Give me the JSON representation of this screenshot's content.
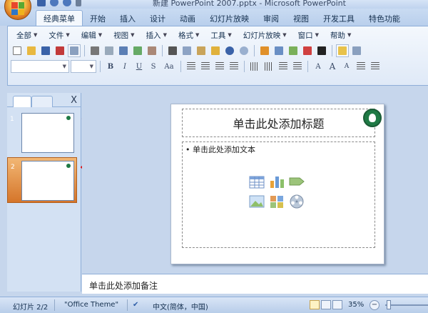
{
  "window": {
    "title": "新建 PowerPoint 2007.pptx - Microsoft PowerPoint"
  },
  "ribbon_tabs": [
    {
      "label": "经典菜单",
      "active": true
    },
    {
      "label": "开始",
      "active": false
    },
    {
      "label": "插入",
      "active": false
    },
    {
      "label": "设计",
      "active": false
    },
    {
      "label": "动画",
      "active": false
    },
    {
      "label": "幻灯片放映",
      "active": false
    },
    {
      "label": "审阅",
      "active": false
    },
    {
      "label": "视图",
      "active": false
    },
    {
      "label": "开发工具",
      "active": false
    },
    {
      "label": "特色功能",
      "active": false
    }
  ],
  "menubar": [
    {
      "label": "全部"
    },
    {
      "label": "文件"
    },
    {
      "label": "编辑"
    },
    {
      "label": "视图"
    },
    {
      "label": "插入"
    },
    {
      "label": "格式"
    },
    {
      "label": "工具"
    },
    {
      "label": "幻灯片放映"
    },
    {
      "label": "窗口"
    },
    {
      "label": "帮助"
    }
  ],
  "format_glyphs": {
    "bold": "B",
    "italic": "I",
    "underline": "U",
    "strike": "S",
    "case": "Aa",
    "font_color": "A",
    "grow": "A",
    "shrink": "A"
  },
  "slide_panel": {
    "close_label": "X",
    "slides": [
      {
        "number": "1"
      },
      {
        "number": "2"
      }
    ]
  },
  "slide": {
    "title_placeholder": "单击此处添加标题",
    "body_placeholder": "• 单击此处添加文本"
  },
  "notes": {
    "placeholder": "单击此处添加备注"
  },
  "statusbar": {
    "slide_counter": "幻灯片 2/2",
    "theme": "\"Office Theme\"",
    "language": "中文(简体，中国)",
    "zoom": "35%",
    "zoom_minus": "−",
    "zoom_plus": "+"
  },
  "colors": {
    "accent_orange": "#d5752a",
    "arrow_red": "#e01818",
    "logo_green": "#1f7a45"
  }
}
